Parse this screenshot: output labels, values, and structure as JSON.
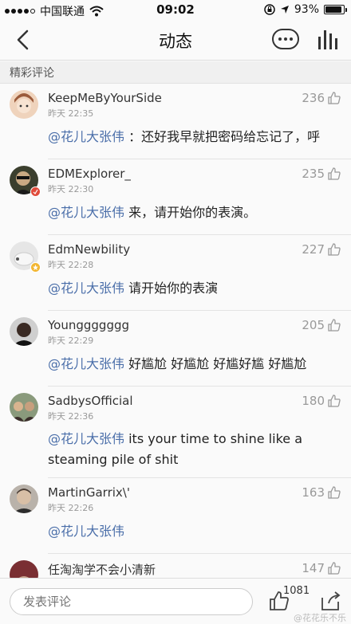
{
  "status_bar": {
    "carrier": "中国联通",
    "time": "09:02",
    "battery_pct": "93%",
    "battery_level": 0.93
  },
  "nav": {
    "title": "动态"
  },
  "section": {
    "label": "精彩评论"
  },
  "comments": [
    {
      "user": "KeepMeByYourSide",
      "time": "昨天 22:35",
      "likes": "236",
      "mention": "@花儿大张伟",
      "text": " ：还好我早就把密码给忘记了，呼",
      "avatar_color": "#e9c6a8"
    },
    {
      "user": "EDMExplorer_",
      "time": "昨天 22:30",
      "likes": "235",
      "mention": "@花儿大张伟",
      "text": " 来，请开始你的表演。",
      "avatar_color": "#3b3f2e"
    },
    {
      "user": "EdmNewbility",
      "time": "昨天 22:28",
      "likes": "227",
      "mention": "@花儿大张伟",
      "text": " 请开始你的表演",
      "avatar_color": "#dcdcdc"
    },
    {
      "user": "Younggggggg",
      "time": "昨天 22:29",
      "likes": "205",
      "mention": "@花儿大张伟",
      "text": " 好尴尬 好尴尬 好尴好尴 好尴尬",
      "avatar_color": "#2a2a2a"
    },
    {
      "user": "SadbysOfficial",
      "time": "昨天 22:36",
      "likes": "180",
      "mention": "@花儿大张伟",
      "text": " its your time to shine like a steaming pile of shit",
      "avatar_color": "#6b5446"
    },
    {
      "user": "MartinGarrix\\'",
      "time": "昨天 22:26",
      "likes": "163",
      "mention": "@花儿大张伟",
      "text": "",
      "avatar_color": "#9a8f85"
    },
    {
      "user": "任淘淘学不会小清新",
      "time": "",
      "likes": "147",
      "mention": "",
      "text": "",
      "avatar_color": "#7a2f33"
    }
  ],
  "footer": {
    "input_placeholder": "发表评论",
    "like_count": "1081",
    "watermark": "@花花乐不乐"
  },
  "colors": {
    "mention": "#4a6ea9",
    "muted": "#999999",
    "background": "#fafafa"
  },
  "icons": [
    "signal-dots-icon",
    "wifi-icon",
    "lock-rotation-icon",
    "location-arrow-icon",
    "battery-icon",
    "back-chevron-icon",
    "more-dots-icon",
    "bars-chart-icon",
    "thumbs-up-icon",
    "share-icon"
  ]
}
